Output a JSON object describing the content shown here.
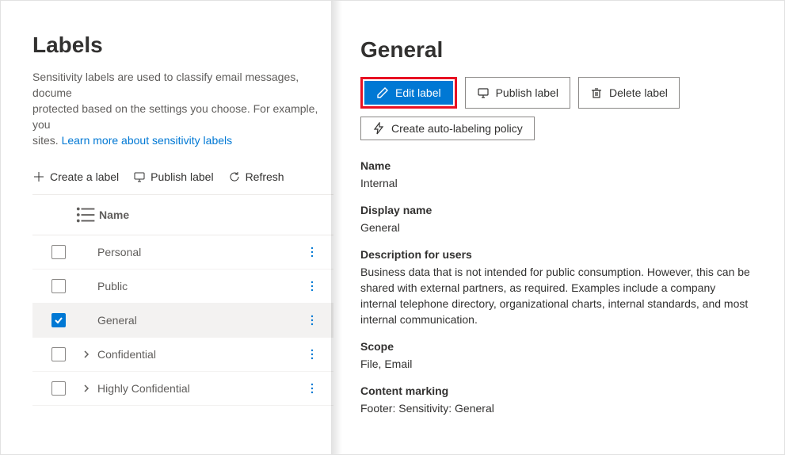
{
  "page": {
    "title": "Labels",
    "description_prefix": "Sensitivity labels are used to classify email messages, docume",
    "description_line2": "protected based on the settings you choose. For example, you",
    "description_line3": "sites. ",
    "learn_more": "Learn more about sensitivity labels"
  },
  "toolbar": {
    "create": "Create a label",
    "publish": "Publish label",
    "refresh": "Refresh"
  },
  "table": {
    "header_name": "Name",
    "rows": [
      {
        "name": "Personal",
        "expandable": false,
        "selected": false
      },
      {
        "name": "Public",
        "expandable": false,
        "selected": false
      },
      {
        "name": "General",
        "expandable": false,
        "selected": true
      },
      {
        "name": "Confidential",
        "expandable": true,
        "selected": false
      },
      {
        "name": "Highly Confidential",
        "expandable": true,
        "selected": false
      }
    ]
  },
  "detail": {
    "title": "General",
    "buttons": {
      "edit": "Edit label",
      "publish": "Publish label",
      "delete": "Delete label",
      "auto": "Create auto-labeling policy"
    },
    "fields": [
      {
        "label": "Name",
        "value": "Internal"
      },
      {
        "label": "Display name",
        "value": "General"
      },
      {
        "label": "Description for users",
        "value": "Business data that is not intended for public consumption. However, this can be shared with external partners, as required. Examples include a company internal telephone directory, organizational charts, internal standards, and most internal communication."
      },
      {
        "label": "Scope",
        "value": "File, Email"
      },
      {
        "label": "Content marking",
        "value": "Footer: Sensitivity: General"
      }
    ]
  }
}
